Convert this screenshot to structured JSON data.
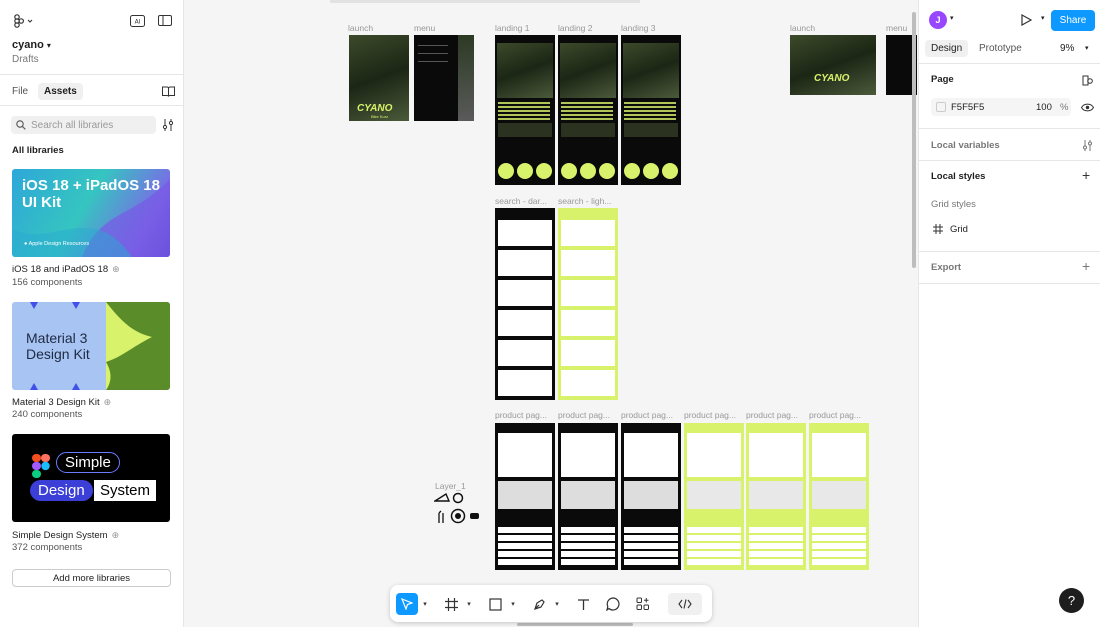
{
  "file": {
    "name": "cyano",
    "location": "Drafts"
  },
  "left_panel": {
    "tabs": [
      "File",
      "Assets"
    ],
    "search_placeholder": "Search all libraries",
    "section_title": "All libraries",
    "libraries": [
      {
        "name": "iOS 18 and iPadOS 18",
        "count": "156 components",
        "thumb_title": "iOS 18 + iPadOS 18 UI Kit",
        "thumb_caption": "Apple Design Resources"
      },
      {
        "name": "Material 3 Design Kit",
        "count": "240 components",
        "thumb_title": "Material 3 Design Kit"
      },
      {
        "name": "Simple Design System",
        "count": "372 components",
        "thumb_words": [
          "Simple",
          "Design",
          "System"
        ]
      }
    ],
    "add_button": "Add more libraries"
  },
  "right_panel": {
    "avatar_initial": "J",
    "share_label": "Share",
    "tabs": [
      "Design",
      "Prototype"
    ],
    "zoom": "9%",
    "page_section": "Page",
    "page_color": "F5F5F5",
    "page_opacity": "100",
    "opacity_unit": "%",
    "local_variables": "Local variables",
    "local_styles": "Local styles",
    "grid_styles": "Grid styles",
    "grid_item": "Grid",
    "export": "Export"
  },
  "canvas": {
    "frame_labels": {
      "launch": "launch",
      "menu": "menu",
      "landing1": "landing 1",
      "landing2": "landing 2",
      "landing3": "landing 3",
      "launch_b": "launch",
      "menu_b": "menu",
      "search_dark": "search - dar...",
      "search_light": "search - ligh...",
      "product": "product pag...",
      "layer": "Layer_1"
    },
    "logo_text": "CYANO",
    "logo_sub": "Bike Kurz"
  },
  "colors": {
    "accent": "#0d99ff",
    "lime": "#d9f26b",
    "avatar": "#9747ff"
  },
  "help_label": "?"
}
